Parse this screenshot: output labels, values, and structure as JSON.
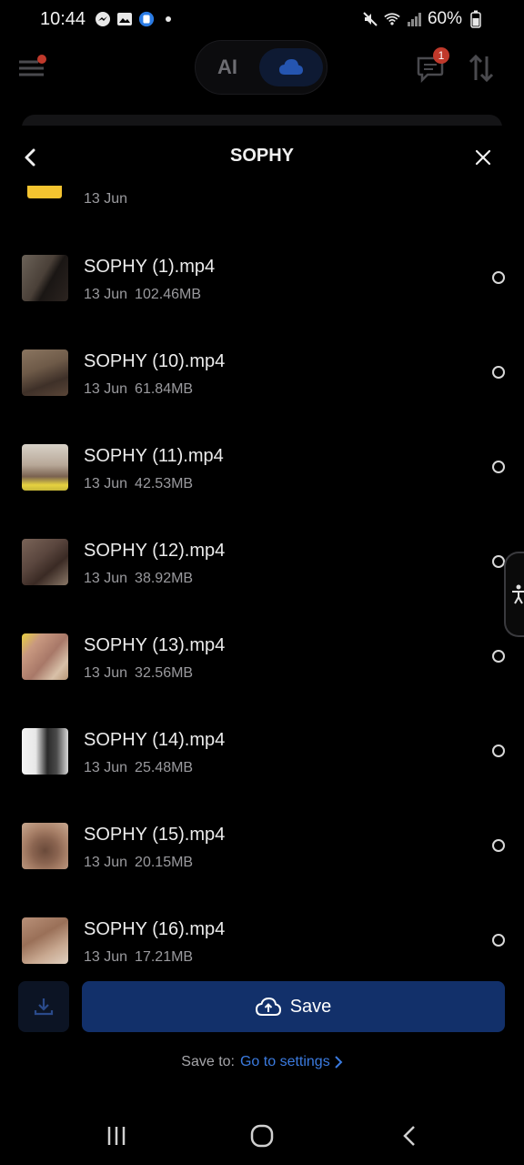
{
  "status_bar": {
    "time": "10:44",
    "left_icons": [
      "messenger-icon",
      "gallery-icon",
      "app-icon",
      "dot-icon"
    ],
    "right_icons": [
      "mute-icon",
      "wifi-icon",
      "signal-icon",
      "battery-icon"
    ],
    "battery": "60%"
  },
  "app_bar": {
    "mode_ai": "AI",
    "message_badge": "1"
  },
  "sheet": {
    "title": "SOPHY",
    "partial_item_date": "13 Jun",
    "files": [
      {
        "name": "SOPHY (1).mp4",
        "date": "13 Jun",
        "size": "102.46MB"
      },
      {
        "name": "SOPHY (10).mp4",
        "date": "13 Jun",
        "size": "61.84MB"
      },
      {
        "name": "SOPHY (11).mp4",
        "date": "13 Jun",
        "size": "42.53MB"
      },
      {
        "name": "SOPHY (12).mp4",
        "date": "13 Jun",
        "size": "38.92MB"
      },
      {
        "name": "SOPHY (13).mp4",
        "date": "13 Jun",
        "size": "32.56MB"
      },
      {
        "name": "SOPHY (14).mp4",
        "date": "13 Jun",
        "size": "25.48MB"
      },
      {
        "name": "SOPHY (15).mp4",
        "date": "13 Jun",
        "size": "20.15MB"
      },
      {
        "name": "SOPHY (16).mp4",
        "date": "13 Jun",
        "size": "17.21MB"
      }
    ],
    "save_label": "Save",
    "save_to_label": "Save to:",
    "settings_link": "Go to settings"
  },
  "colors": {
    "accent": "#3b7be0",
    "save_button": "#12306a",
    "badge": "#c0392b"
  }
}
